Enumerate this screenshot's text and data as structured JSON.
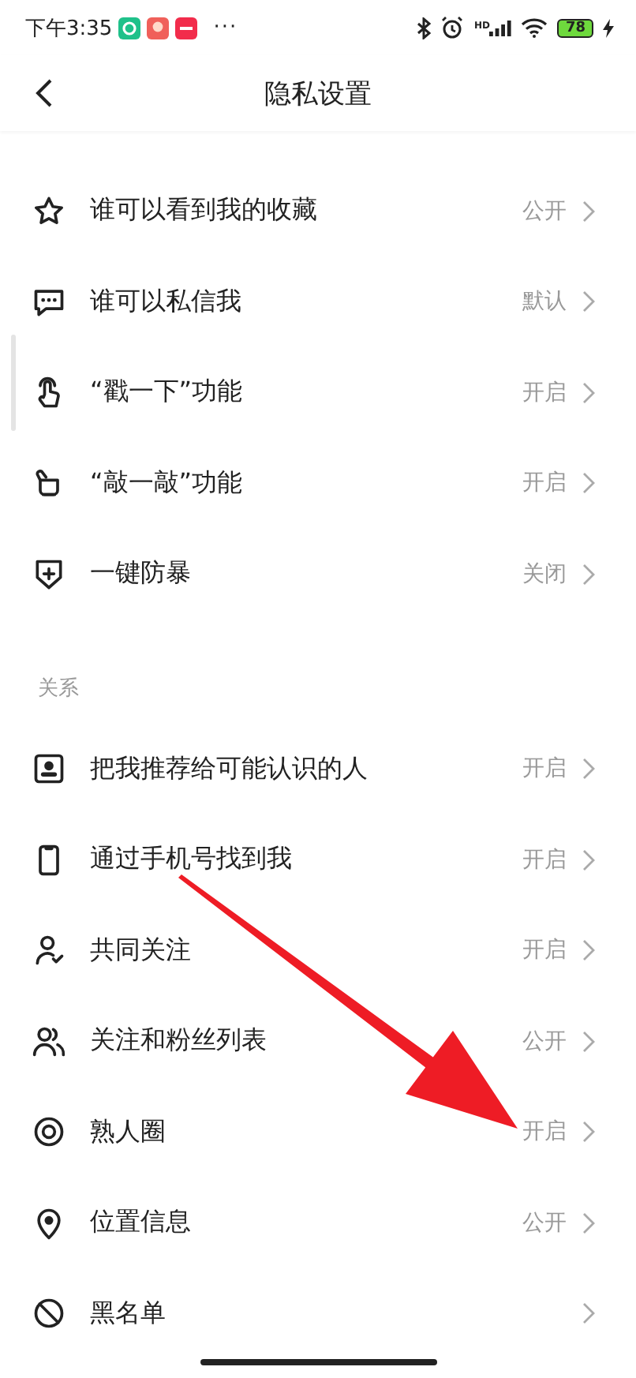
{
  "status_bar": {
    "time": "下午3:35",
    "more": "···",
    "signal_label": "HD",
    "battery": "78"
  },
  "header": {
    "title": "隐私设置"
  },
  "sections": [
    {
      "items": [
        {
          "label": "谁可以看到我的收藏",
          "value": "公开"
        },
        {
          "label": "谁可以私信我",
          "value": "默认"
        },
        {
          "label": "“戳一下”功能",
          "value": "开启"
        },
        {
          "label": "“敲一敲”功能",
          "value": "开启"
        },
        {
          "label": "一键防暴",
          "value": "关闭"
        }
      ]
    },
    {
      "title": "关系",
      "items": [
        {
          "label": "把我推荐给可能认识的人",
          "value": "开启"
        },
        {
          "label": "通过手机号找到我",
          "value": "开启"
        },
        {
          "label": "共同关注",
          "value": "开启"
        },
        {
          "label": "关注和粉丝列表",
          "value": "公开"
        },
        {
          "label": "熟人圈",
          "value": "开启"
        },
        {
          "label": "位置信息",
          "value": "公开"
        },
        {
          "label": "黑名单"
        }
      ]
    }
  ]
}
